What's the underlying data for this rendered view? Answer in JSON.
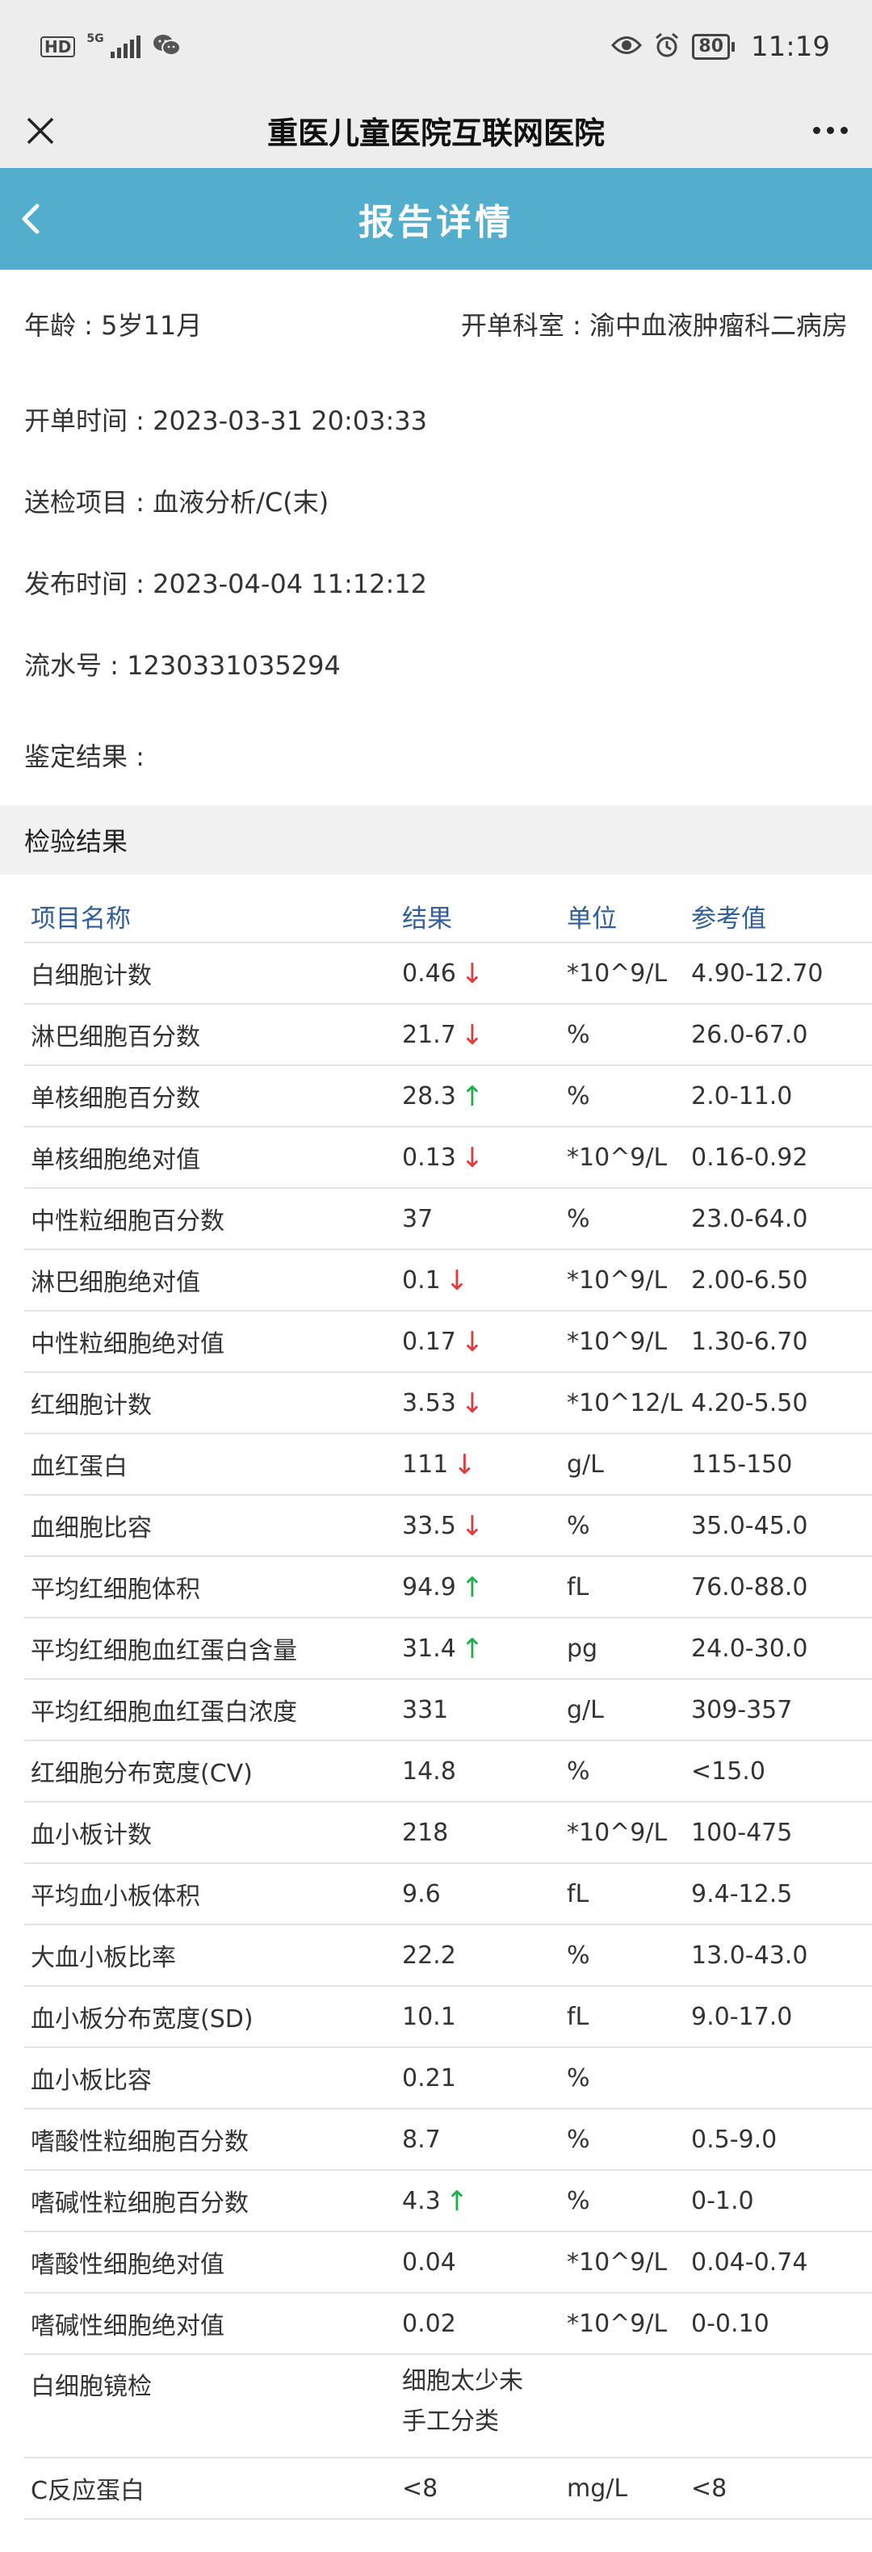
{
  "status_bar": {
    "network_hd": "HD",
    "network_5g": "5G",
    "battery": "80",
    "time": "11:19"
  },
  "nav": {
    "title": "重医儿童医院互联网医院"
  },
  "header": {
    "title": "报告详情"
  },
  "info": {
    "age": "年龄 : 5岁11月",
    "department": "开单科室 : 渝中血液肿瘤科二病房",
    "order_time": "开单时间 : 2023-03-31 20:03:33",
    "exam_item": "送检项目 : 血液分析/C(末)",
    "publish_time": "发布时间 : 2023-04-04 11:12:12",
    "serial_no": "流水号 : 1230331035294",
    "conclusion": "鉴定结果 :"
  },
  "section": {
    "title": "检验结果"
  },
  "table": {
    "headers": [
      "项目名称",
      "结果",
      "单位",
      "参考值"
    ],
    "rows": [
      {
        "name": "白细胞计数",
        "result": "0.46",
        "flag": "down",
        "unit": "*10^9/L",
        "ref": "4.90-12.70"
      },
      {
        "name": "淋巴细胞百分数",
        "result": "21.7",
        "flag": "down",
        "unit": "%",
        "ref": "26.0-67.0"
      },
      {
        "name": "单核细胞百分数",
        "result": "28.3",
        "flag": "up",
        "unit": "%",
        "ref": "2.0-11.0"
      },
      {
        "name": "单核细胞绝对值",
        "result": "0.13",
        "flag": "down",
        "unit": "*10^9/L",
        "ref": "0.16-0.92"
      },
      {
        "name": "中性粒细胞百分数",
        "result": "37",
        "flag": "",
        "unit": "%",
        "ref": "23.0-64.0"
      },
      {
        "name": "淋巴细胞绝对值",
        "result": "0.1",
        "flag": "down",
        "unit": "*10^9/L",
        "ref": "2.00-6.50"
      },
      {
        "name": "中性粒细胞绝对值",
        "result": "0.17",
        "flag": "down",
        "unit": "*10^9/L",
        "ref": "1.30-6.70"
      },
      {
        "name": "红细胞计数",
        "result": "3.53",
        "flag": "down",
        "unit": "*10^12/L",
        "ref": "4.20-5.50"
      },
      {
        "name": "血红蛋白",
        "result": "111",
        "flag": "down",
        "unit": "g/L",
        "ref": "115-150"
      },
      {
        "name": "血细胞比容",
        "result": "33.5",
        "flag": "down",
        "unit": "%",
        "ref": "35.0-45.0"
      },
      {
        "name": "平均红细胞体积",
        "result": "94.9",
        "flag": "up",
        "unit": "fL",
        "ref": "76.0-88.0"
      },
      {
        "name": "平均红细胞血红蛋白含量",
        "result": "31.4",
        "flag": "up",
        "unit": "pg",
        "ref": "24.0-30.0"
      },
      {
        "name": "平均红细胞血红蛋白浓度",
        "result": "331",
        "flag": "",
        "unit": "g/L",
        "ref": "309-357"
      },
      {
        "name": "红细胞分布宽度(CV)",
        "result": "14.8",
        "flag": "",
        "unit": "%",
        "ref": "<15.0"
      },
      {
        "name": "血小板计数",
        "result": "218",
        "flag": "",
        "unit": "*10^9/L",
        "ref": "100-475"
      },
      {
        "name": "平均血小板体积",
        "result": "9.6",
        "flag": "",
        "unit": "fL",
        "ref": "9.4-12.5"
      },
      {
        "name": "大血小板比率",
        "result": "22.2",
        "flag": "",
        "unit": "%",
        "ref": "13.0-43.0"
      },
      {
        "name": "血小板分布宽度(SD)",
        "result": "10.1",
        "flag": "",
        "unit": "fL",
        "ref": "9.0-17.0"
      },
      {
        "name": "血小板比容",
        "result": "0.21",
        "flag": "",
        "unit": "%",
        "ref": ""
      },
      {
        "name": "嗜酸性粒细胞百分数",
        "result": "8.7",
        "flag": "",
        "unit": "%",
        "ref": "0.5-9.0"
      },
      {
        "name": "嗜碱性粒细胞百分数",
        "result": "4.3",
        "flag": "up",
        "unit": "%",
        "ref": "0-1.0"
      },
      {
        "name": "嗜酸性细胞绝对值",
        "result": "0.04",
        "flag": "",
        "unit": "*10^9/L",
        "ref": "0.04-0.74"
      },
      {
        "name": "嗜碱性细胞绝对值",
        "result": "0.02",
        "flag": "",
        "unit": "*10^9/L",
        "ref": "0-0.10"
      },
      {
        "name": "白细胞镜检",
        "result": "细胞太少未手工分类",
        "flag": "",
        "unit": "",
        "ref": ""
      },
      {
        "name": "C反应蛋白",
        "result": "<8",
        "flag": "",
        "unit": "mg/L",
        "ref": "<8"
      }
    ]
  },
  "flag_symbols": {
    "up": "↑",
    "down": "↓"
  },
  "colors": {
    "header_bg": "#53adcd",
    "down_arrow": "#e23b3b",
    "up_arrow": "#1fae4c",
    "column_header": "#2f5f9a"
  },
  "icons": [
    "close-icon",
    "more-icon",
    "back-chevron-icon",
    "eye-icon",
    "alarm-icon",
    "wechat-icon",
    "signal-icon",
    "battery-icon"
  ]
}
